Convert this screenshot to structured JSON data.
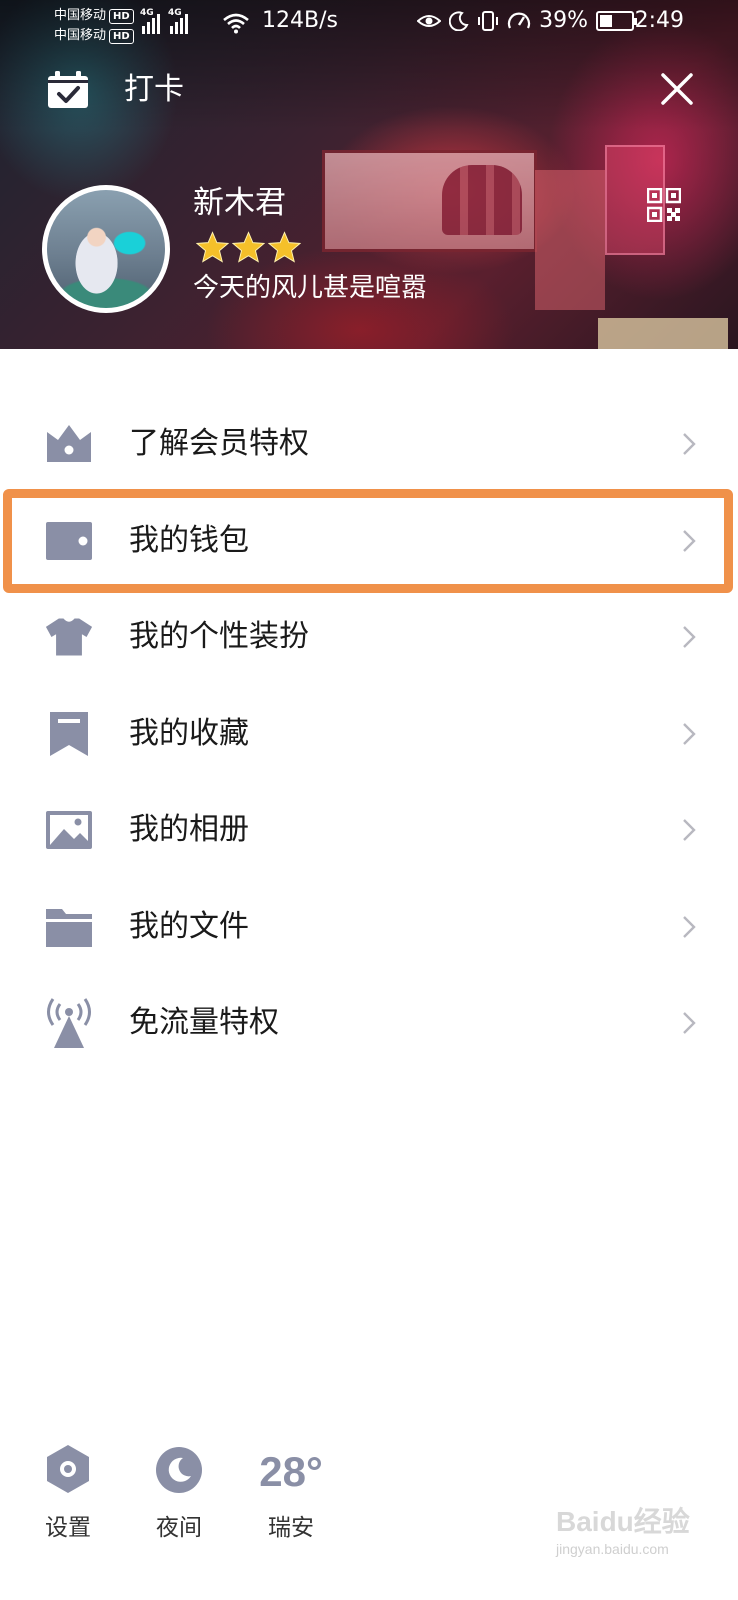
{
  "status_bar": {
    "carrier_1": "中国移动",
    "carrier_2": "中国移动",
    "hd_badge": "HD",
    "network_type": "4G",
    "net_speed": "124B/s",
    "battery_percent": "39%",
    "battery_level": 0.39,
    "time": "2:49"
  },
  "header": {
    "checkin_label": "打卡",
    "nickname": "新木君",
    "star_count": 3,
    "signature": "今天的风儿甚是喧嚣"
  },
  "menu": {
    "items": [
      {
        "label": "了解会员特权",
        "icon": "vip-crown-icon"
      },
      {
        "label": "我的钱包",
        "icon": "wallet-icon"
      },
      {
        "label": "我的个性装扮",
        "icon": "tshirt-icon"
      },
      {
        "label": "我的收藏",
        "icon": "bookmark-icon"
      },
      {
        "label": "我的相册",
        "icon": "photo-album-icon"
      },
      {
        "label": "我的文件",
        "icon": "folder-icon"
      },
      {
        "label": "免流量特权",
        "icon": "signal-tower-icon"
      }
    ],
    "highlighted_index": 1
  },
  "bottom": {
    "settings_label": "设置",
    "night_label": "夜间",
    "temperature": "28°",
    "city": "瑞安"
  },
  "watermark": {
    "main": "Baidu经验",
    "sub": "jingyan.baidu.com"
  },
  "colors": {
    "icon_gray": "#8a8fa6",
    "arrow_gray": "#b8b8c0",
    "highlight_orange": "#f0914a",
    "star_gold": "#f5c02a"
  }
}
